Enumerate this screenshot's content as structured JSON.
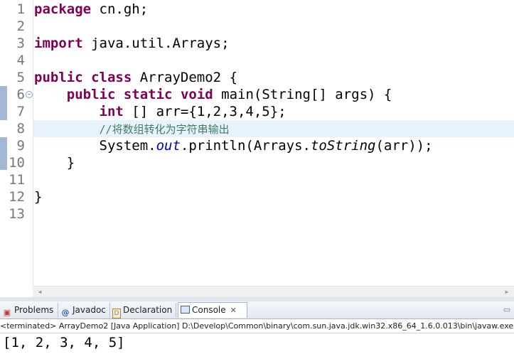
{
  "editor": {
    "lines": [
      {
        "num": "1",
        "code": [
          {
            "t": "package",
            "k": "kw"
          },
          {
            "t": " cn.gh;"
          }
        ]
      },
      {
        "num": "2",
        "code": []
      },
      {
        "num": "3",
        "code": [
          {
            "t": "import",
            "k": "kw"
          },
          {
            "t": " java.util.Arrays;"
          }
        ]
      },
      {
        "num": "4",
        "code": []
      },
      {
        "num": "5",
        "code": [
          {
            "t": "public",
            "k": "kw"
          },
          {
            "t": " "
          },
          {
            "t": "class",
            "k": "kw"
          },
          {
            "t": " ArrayDemo2 {"
          }
        ]
      },
      {
        "num": "6",
        "fold": true,
        "code": [
          {
            "t": "    "
          },
          {
            "t": "public",
            "k": "kw"
          },
          {
            "t": " "
          },
          {
            "t": "static",
            "k": "kw"
          },
          {
            "t": " "
          },
          {
            "t": "void",
            "k": "kw"
          },
          {
            "t": " main(String[] args) {"
          }
        ]
      },
      {
        "num": "7",
        "code": [
          {
            "t": "        "
          },
          {
            "t": "int",
            "k": "kw"
          },
          {
            "t": " [] arr={1,2,3,4,5};"
          }
        ]
      },
      {
        "num": "8",
        "current": true,
        "code": [
          {
            "t": "        "
          },
          {
            "t": "//将数组转化为字符串输出",
            "k": "comment"
          }
        ]
      },
      {
        "num": "9",
        "code": [
          {
            "t": "        System."
          },
          {
            "t": "out",
            "k": "field"
          },
          {
            "t": ".println(Arrays."
          },
          {
            "t": "toString",
            "k": "static-m"
          },
          {
            "t": "(arr));"
          }
        ]
      },
      {
        "num": "10",
        "code": [
          {
            "t": "    }"
          }
        ]
      },
      {
        "num": "11",
        "code": []
      },
      {
        "num": "12",
        "code": [
          {
            "t": "}"
          }
        ]
      },
      {
        "num": "13",
        "code": []
      }
    ]
  },
  "panel": {
    "tabs": {
      "problems": "Problems",
      "javadoc": "Javadoc",
      "declaration": "Declaration",
      "console": "Console"
    },
    "console_status": "<terminated> ArrayDemo2 [Java Application] D:\\Develop\\Common\\binary\\com.sun.java.jdk.win32.x86_64_1.6.0.013\\bin\\javaw.exe",
    "console_output": "[1, 2, 3, 4, 5]"
  }
}
